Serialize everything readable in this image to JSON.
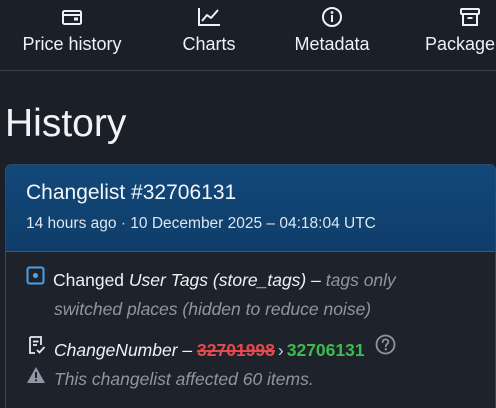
{
  "nav": {
    "tabs": [
      {
        "label": "Price history",
        "icon": "wallet-icon"
      },
      {
        "label": "Charts",
        "icon": "line-chart-icon"
      },
      {
        "label": "Metadata",
        "icon": "info-icon"
      },
      {
        "label": "Package",
        "icon": "archive-icon"
      }
    ]
  },
  "page": {
    "title": "History"
  },
  "changelist": {
    "title": "Changelist #32706131",
    "relative_time": "14 hours ago",
    "separator": "·",
    "datetime": "10 December 2025 – 04:18:04 UTC",
    "entries": {
      "tags": {
        "icon": "dot-square-icon",
        "changed_word": "Changed",
        "field": "User Tags (store_tags)",
        "dash": "–",
        "note_line1": "tags only",
        "note_line2": "switched places (hidden to reduce noise)"
      },
      "change_number": {
        "icon": "checklist-icon",
        "field": "ChangeNumber",
        "dash": "–",
        "old_value": "32701998",
        "arrow": "›",
        "new_value": "32706131",
        "help_icon": "question-circle-icon"
      },
      "warning": {
        "icon": "warning-triangle-icon",
        "text": "This changelist affected 60 items."
      }
    }
  },
  "colors": {
    "background": "#1b2028",
    "card_header": "#12487a",
    "removed": "#e5484d",
    "added": "#3fb950",
    "muted": "#8d96a3",
    "accent_icon": "#4a9fe8"
  }
}
